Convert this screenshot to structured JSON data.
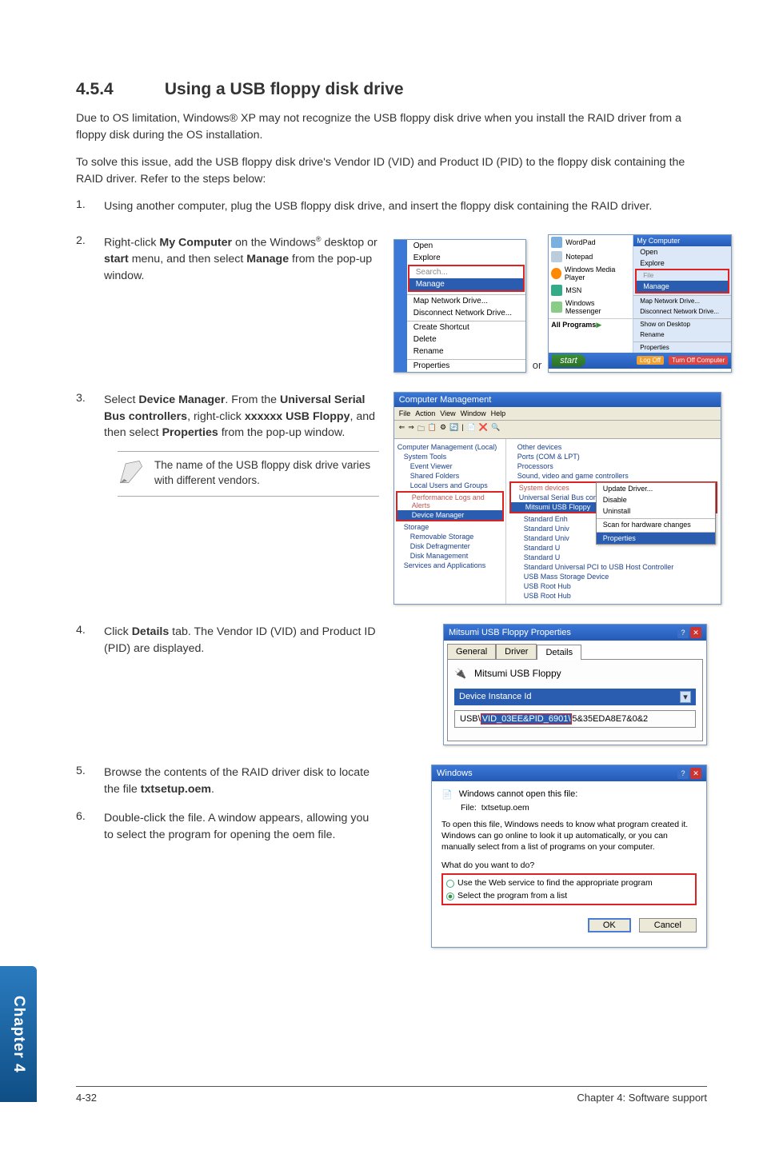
{
  "heading_num": "4.5.4",
  "heading_title": "Using a USB floppy disk drive",
  "intro_1": "Due to OS limitation, Windows® XP may not recognize the USB floppy disk drive when you install the RAID driver from a floppy disk during the OS installation.",
  "intro_2": "To solve this issue, add the USB floppy disk drive's Vendor ID (VID) and Product ID (PID) to the floppy disk containing the RAID driver. Refer to the steps below:",
  "steps": {
    "s1": {
      "n": "1.",
      "t": "Using another computer, plug the USB floppy disk drive, and insert the floppy disk containing the RAID driver."
    },
    "s2": {
      "n": "2.",
      "t_pre": "Right-click ",
      "b1": "My Computer",
      "t_mid": " on the Windows",
      "sup": "®",
      "t_mid2": " desktop or ",
      "b2": "start",
      "t_mid3": " menu, and then select ",
      "b3": "Manage",
      "t_end": " from the pop-up window."
    },
    "s3": {
      "n": "3.",
      "t_pre": "Select ",
      "b1": "Device Manager",
      "t_mid": ". From the ",
      "b2": "Universal Serial Bus controllers",
      "t_mid2": ", right-click ",
      "b3": "xxxxxx USB Floppy",
      "t_mid3": ", and then select ",
      "b4": "Properties",
      "t_end": " from the pop-up window."
    },
    "s4": {
      "n": "4.",
      "t_pre": "Click ",
      "b1": "Details",
      "t_end": " tab. The Vendor ID (VID) and Product ID (PID) are displayed."
    },
    "s5": {
      "n": "5.",
      "t_pre": "Browse the contents of the RAID driver disk to locate the file ",
      "b1": "txtsetup.oem",
      "t_end": "."
    },
    "s6": {
      "n": "6.",
      "t": "Double-click the file. A window appears, allowing you to select the program for opening the oem file."
    }
  },
  "note": {
    "text": "The name of the USB floppy disk drive varies with different vendors."
  },
  "img2_menu": {
    "open": "Open",
    "explore": "Explore",
    "search": "Search...",
    "manage": "Manage",
    "map": "Map Network Drive...",
    "disc": "Disconnect Network Drive...",
    "shortcut": "Create Shortcut",
    "delete": "Delete",
    "rename": "Rename",
    "props": "Properties"
  },
  "img2_title": "My Computer",
  "taskbar": {
    "start": "start",
    "logoff": "Log Off",
    "turnoff": "Turn Off Computer"
  },
  "img2_right": {
    "items": [
      "WordPad",
      "Notepad",
      "Windows Media Player",
      "MSN",
      "Windows Messenger",
      "All Programs"
    ],
    "rOpen": "Open",
    "rExplore": "Explore",
    "rManage": "Manage",
    "rMap": "Map Network Drive...",
    "rDisc": "Disconnect Network Drive...",
    "rShow": "Show on Desktop",
    "rRename": "Rename",
    "rProps": "Properties"
  },
  "or_label": "or",
  "devmgr": {
    "title": "Computer Management",
    "menus": [
      "File",
      "Action",
      "View",
      "Window",
      "Help"
    ],
    "left": [
      "Computer Management (Local)",
      "System Tools",
      "Event Viewer",
      "Shared Folders",
      "Local Users and Groups",
      "Performance Logs and Alerts",
      "Device Manager",
      "Storage",
      "Removable Storage",
      "Disk Defragmenter",
      "Disk Management",
      "Services and Applications"
    ],
    "right": [
      "Other devices",
      "Ports (COM & LPT)",
      "Processors",
      "Sound, video and game controllers",
      "System devices",
      "Universal Serial Bus controllers",
      "Mitsumi USB Floppy",
      "Standard Enh",
      "Standard Univ",
      "Standard Univ",
      "Standard U",
      "Standard U",
      "Standard Universal PCI to USB Host Controller",
      "USB Mass Storage Device",
      "USB Root Hub",
      "USB Root Hub"
    ],
    "submenu": {
      "update": "Update Driver...",
      "disable": "Disable",
      "uninstall": "Uninstall",
      "scan": "Scan for hardware changes",
      "props": "Properties"
    }
  },
  "propdlg": {
    "title": "Mitsumi USB Floppy Properties",
    "tabs": {
      "general": "General",
      "driver": "Driver",
      "details": "Details"
    },
    "devname": "Mitsumi USB Floppy",
    "combo": "Device Instance Id",
    "usb_raw": "USB\\VID_03EE&PID_6901\\5&35EDA8E7&0&2",
    "usb_pre": "USB\\",
    "usb_hl": "VID_03EE&PID_6901\\",
    "usb_post": "5&35EDA8E7&0&2"
  },
  "openwith": {
    "title": "Windows",
    "l1": "Windows cannot open this file:",
    "file_label": "File:",
    "file_name": "txtsetup.oem",
    "info": "To open this file, Windows needs to know what program created it.  Windows can go online to look it up automatically, or you can manually select from a list of programs on your computer.",
    "prompt": "What do you want to do?",
    "r1": "Use the Web service to find the appropriate program",
    "r2": "Select the program from a list",
    "ok": "OK",
    "cancel": "Cancel"
  },
  "side_tab": "Chapter 4",
  "footer": {
    "left": "4-32",
    "right": "Chapter 4: Software support"
  }
}
